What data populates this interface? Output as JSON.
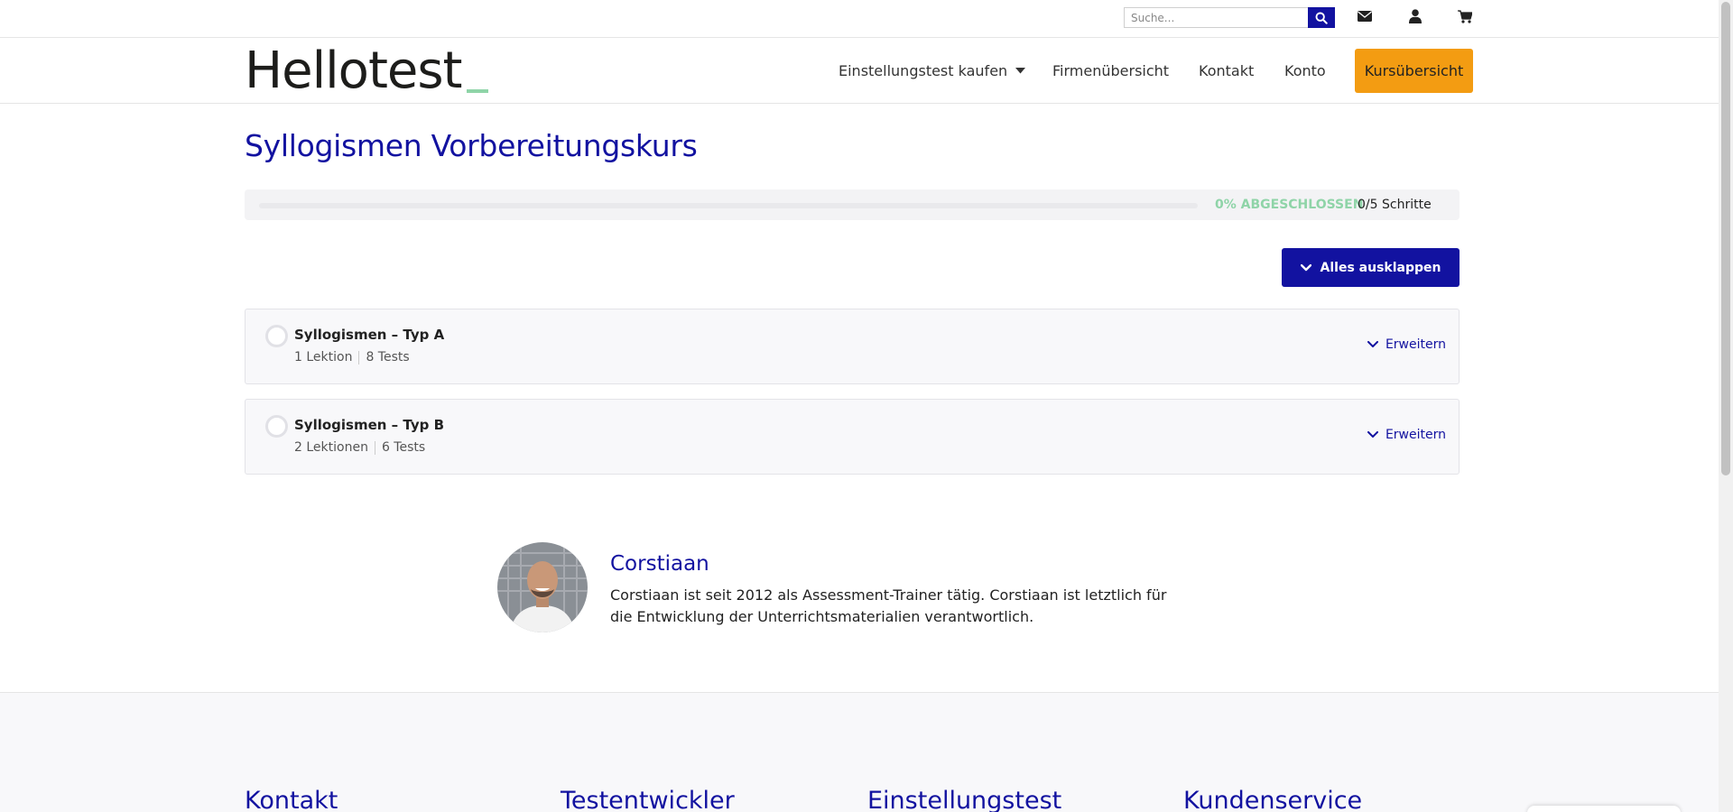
{
  "topbar": {
    "search_placeholder": "Suche...",
    "icons": [
      "search-icon",
      "envelope-icon",
      "user-icon",
      "cart-icon"
    ]
  },
  "header": {
    "logo": "Hellotest",
    "nav": [
      {
        "label": "Einstellungstest kaufen",
        "has_dropdown": true
      },
      {
        "label": "Firmenübersicht"
      },
      {
        "label": "Kontakt"
      },
      {
        "label": "Konto"
      }
    ],
    "cta": "Kursübersicht"
  },
  "course": {
    "title": "Syllogismen Vorbereitungskurs",
    "progress_percent": 0,
    "progress_label": "0% ABGESCHLOSSEN",
    "steps_label": "0/5 Schritte",
    "expand_all": "Alles ausklappen",
    "sections": [
      {
        "title": "Syllogismen – Typ A",
        "lessons": "1 Lektion",
        "tests": "8 Tests",
        "toggle": "Erweitern"
      },
      {
        "title": "Syllogismen – Typ B",
        "lessons": "2 Lektionen",
        "tests": "6 Tests",
        "toggle": "Erweitern"
      }
    ]
  },
  "author": {
    "name": "Corstiaan",
    "bio": "Corstiaan ist seit 2012 als Assessment-Trainer tätig. Corstiaan ist letztlich für die Entwicklung der Unterrichtsmaterialien verantwortlich."
  },
  "footer": {
    "headings": [
      "Kontakt",
      "Testentwickler",
      "Einstellungstest",
      "Kundenservice"
    ]
  },
  "colors": {
    "brand_blue": "#1212a0",
    "accent_orange": "#f39c12",
    "progress_green": "#8fd4a8"
  }
}
